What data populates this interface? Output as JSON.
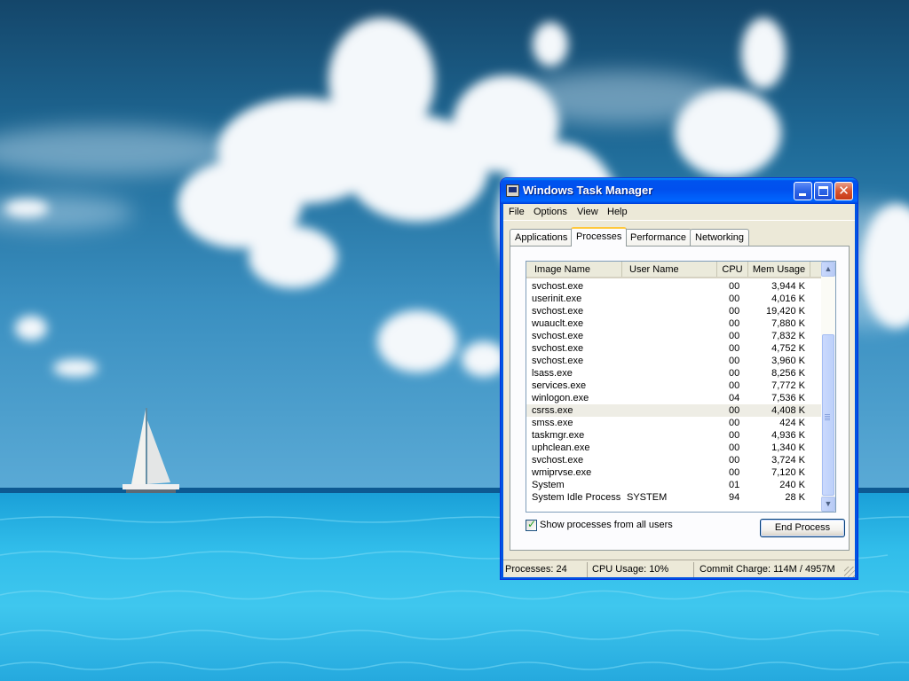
{
  "window": {
    "title": "Windows Task Manager"
  },
  "menu": {
    "items": [
      "File",
      "Options",
      "View",
      "Help"
    ]
  },
  "tabs": [
    {
      "label": "Applications"
    },
    {
      "label": "Processes"
    },
    {
      "label": "Performance"
    },
    {
      "label": "Networking"
    }
  ],
  "active_tab": "Processes",
  "processes": {
    "columns": [
      "Image Name",
      "User Name",
      "CPU",
      "Mem Usage"
    ],
    "rows": [
      {
        "name": "svchost.exe",
        "user": "",
        "cpu": "00",
        "mem": "3,944 K"
      },
      {
        "name": "userinit.exe",
        "user": "",
        "cpu": "00",
        "mem": "4,016 K"
      },
      {
        "name": "svchost.exe",
        "user": "",
        "cpu": "00",
        "mem": "19,420 K"
      },
      {
        "name": "wuauclt.exe",
        "user": "",
        "cpu": "00",
        "mem": "7,880 K"
      },
      {
        "name": "svchost.exe",
        "user": "",
        "cpu": "00",
        "mem": "7,832 K"
      },
      {
        "name": "svchost.exe",
        "user": "",
        "cpu": "00",
        "mem": "4,752 K"
      },
      {
        "name": "svchost.exe",
        "user": "",
        "cpu": "00",
        "mem": "3,960 K"
      },
      {
        "name": "lsass.exe",
        "user": "",
        "cpu": "00",
        "mem": "8,256 K"
      },
      {
        "name": "services.exe",
        "user": "",
        "cpu": "00",
        "mem": "7,772 K"
      },
      {
        "name": "winlogon.exe",
        "user": "",
        "cpu": "04",
        "mem": "7,536 K"
      },
      {
        "name": "csrss.exe",
        "user": "",
        "cpu": "00",
        "mem": "4,408 K"
      },
      {
        "name": "smss.exe",
        "user": "",
        "cpu": "00",
        "mem": "424 K"
      },
      {
        "name": "taskmgr.exe",
        "user": "",
        "cpu": "00",
        "mem": "4,936 K"
      },
      {
        "name": "uphclean.exe",
        "user": "",
        "cpu": "00",
        "mem": "1,340 K"
      },
      {
        "name": "svchost.exe",
        "user": "",
        "cpu": "00",
        "mem": "3,724 K"
      },
      {
        "name": "wmiprvse.exe",
        "user": "",
        "cpu": "00",
        "mem": "7,120 K"
      },
      {
        "name": "System",
        "user": "",
        "cpu": "01",
        "mem": "240 K"
      },
      {
        "name": "System Idle Process",
        "user": "SYSTEM",
        "cpu": "94",
        "mem": "28 K"
      }
    ],
    "selected_index": 10
  },
  "show_all_users": {
    "label": "Show processes from all users",
    "checked": true
  },
  "end_process_label": "End Process",
  "status": {
    "processes": "Processes: 24",
    "cpu": "CPU Usage: 10%",
    "commit": "Commit Charge: 114M / 4957M"
  },
  "icons": {
    "window": "task-manager-icon",
    "minimize": "minimize-icon",
    "maximize": "maximize-icon",
    "close": "close-icon",
    "scroll_up": "scroll-up-arrow-icon",
    "scroll_down": "scroll-down-arrow-icon",
    "checkbox_check": "checkmark-icon"
  },
  "colors": {
    "titlebar": "#0054e3",
    "window_face": "#ece9d8",
    "tab_highlight": "#ffc83c",
    "close_button": "#d8542f"
  }
}
